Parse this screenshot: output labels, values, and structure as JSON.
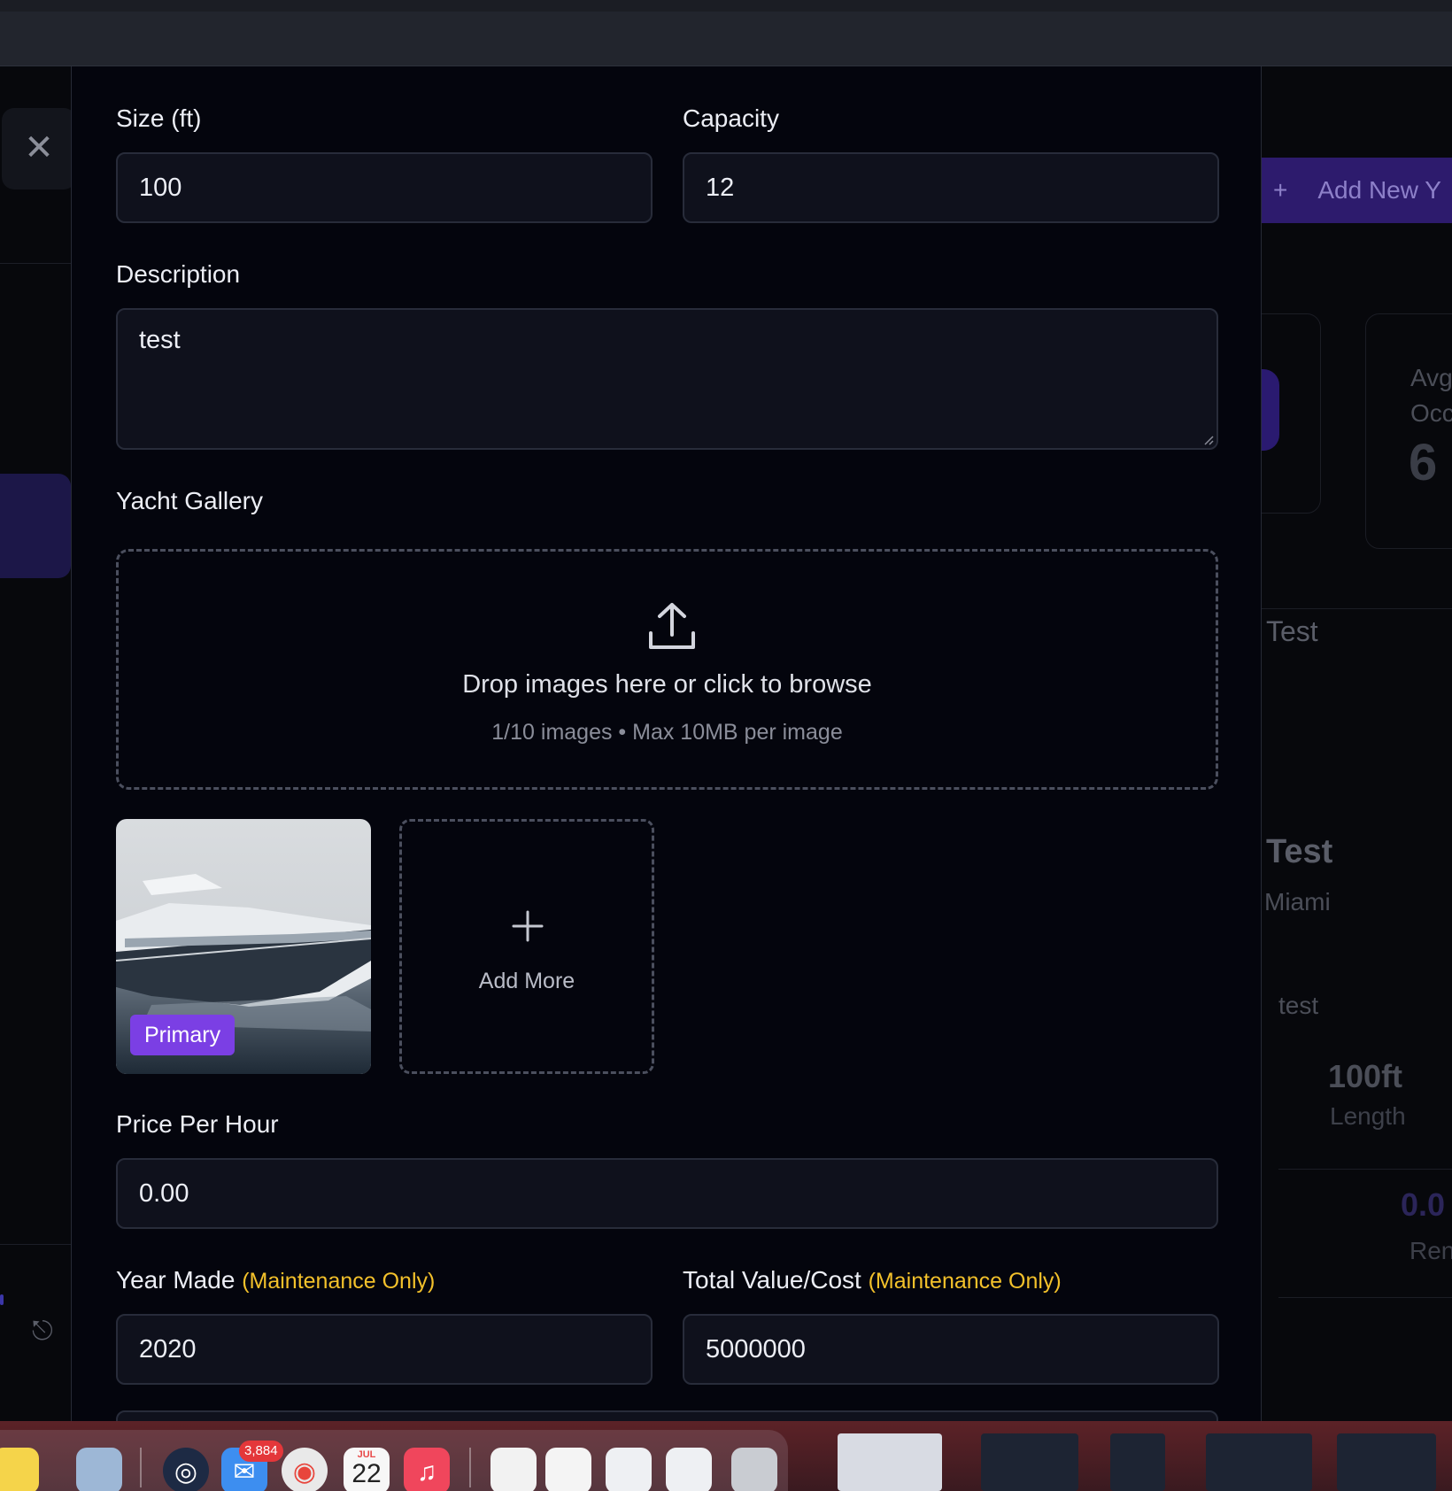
{
  "background": {
    "add_new_label": "Add New Y",
    "card_label_line1": "Avg",
    "card_label_line2": "Occ",
    "card_value": "6",
    "yacht_name_a": "Test",
    "yacht_name_b": "Test",
    "yacht_location": "Miami",
    "yacht_desc": "test",
    "stat_value": "100ft",
    "stat_label": "Length",
    "rate_value": "0.0",
    "rate_label": "Ren"
  },
  "form": {
    "size_label": "Size (ft)",
    "size_value": "100",
    "capacity_label": "Capacity",
    "capacity_value": "12",
    "description_label": "Description",
    "description_value": "test",
    "gallery_label": "Yacht Gallery",
    "dropzone_text": "Drop images here or click to browse",
    "dropzone_sub": "1/10 images • Max 10MB per image",
    "primary_badge": "Primary",
    "add_more_label": "Add More",
    "price_label": "Price Per Hour",
    "price_value": "0.00",
    "year_label": "Year Made",
    "year_note": "(Maintenance Only)",
    "year_value": "2020",
    "total_label": "Total Value/Cost",
    "total_note": "(Maintenance Only)",
    "total_value": "5000000"
  },
  "dock": {
    "mail_badge": "3,884",
    "calendar_month": "JUL",
    "calendar_day": "22"
  },
  "colors": {
    "accent": "#7b3fe4",
    "maintenance_note": "#f3c12b",
    "field_bg": "#0f111c",
    "modal_bg": "#04050d"
  },
  "icons": {
    "close": "close-icon",
    "upload": "upload-icon",
    "add": "plus-icon",
    "logout": "logout-icon"
  }
}
